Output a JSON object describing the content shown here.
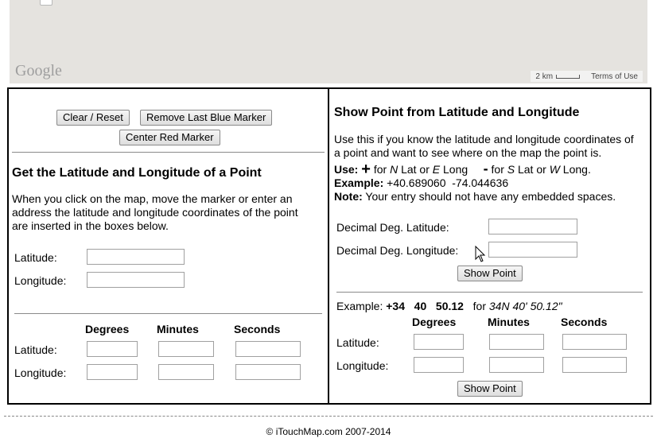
{
  "map": {
    "logo": "Google",
    "scale": "2 km",
    "terms": "Terms of Use"
  },
  "left": {
    "buttons": {
      "clear_reset": "Clear / Reset",
      "remove_blue": "Remove Last Blue Marker",
      "center_red": "Center Red Marker"
    },
    "heading": "Get the Latitude and Longitude of a Point",
    "description_lines": [
      "When you click on the map, move the marker or enter an",
      "address the latitude and longitude coordinates of the point",
      "are inserted in the boxes below."
    ],
    "latitude_label": "Latitude:",
    "longitude_label": "Longitude:",
    "dms": {
      "degrees": "Degrees",
      "minutes": "Minutes",
      "seconds": "Seconds",
      "latitude_label": "Latitude:",
      "longitude_label": "Longitude:"
    }
  },
  "right": {
    "heading": "Show Point from Latitude and Longitude",
    "description_lines": [
      "Use this if you know the latitude and longitude coordinates of",
      "a point and want to see where on the map the point is."
    ],
    "use_line": {
      "use": "Use:",
      "plus": "+",
      "for_n": "for",
      "n": "N",
      "lat_or": "Lat or",
      "e": "E",
      "long": "Long",
      "minus": "-",
      "for_s": "for",
      "s": "S",
      "lat_or2": "Lat or",
      "w": "W",
      "long2": "Long."
    },
    "example_label": "Example:",
    "example_value": "+40.689060  -74.044636",
    "note_label": "Note:",
    "note_text": "Your entry should not have any embedded spaces.",
    "dec_lat_label": "Decimal Deg. Latitude:",
    "dec_lon_label": "Decimal Deg. Longitude:",
    "show_point": "Show Point",
    "dms_example": {
      "prefix": "Example:",
      "deg": "+34",
      "min": "40",
      "sec": "50.12",
      "for": "for",
      "formatted": "34N 40' 50.12\""
    },
    "dms": {
      "degrees": "Degrees",
      "minutes": "Minutes",
      "seconds": "Seconds",
      "latitude_label": "Latitude:",
      "longitude_label": "Longitude:"
    },
    "show_point_2": "Show Point"
  },
  "footer": {
    "copyright": "© iTouchMap.com 2007-2014"
  }
}
